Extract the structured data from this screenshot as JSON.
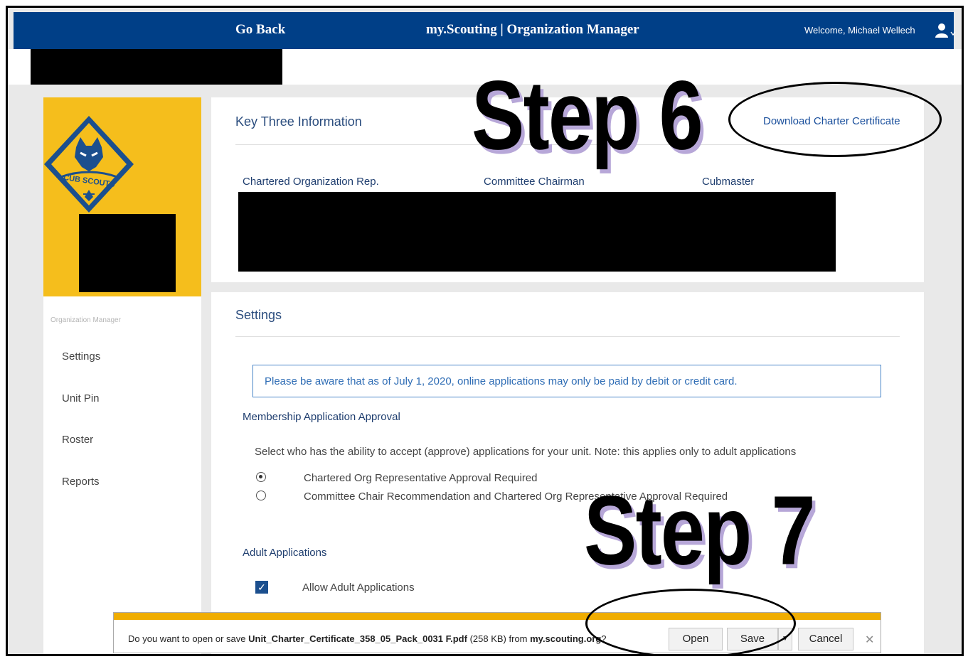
{
  "header": {
    "go_back": "Go Back",
    "brand": "my.Scouting |",
    "brand_section": "Organization Manager",
    "welcome": "Welcome, Michael Wellech",
    "user_icon": "user-icon"
  },
  "sidebar": {
    "logo_text": "CUB SCOUTS",
    "heading": "Organization Manager",
    "items": [
      {
        "label": "Settings"
      },
      {
        "label": "Unit Pin"
      },
      {
        "label": "Roster"
      },
      {
        "label": "Reports"
      }
    ]
  },
  "key_three": {
    "title": "Key Three Information",
    "download_link": "Download Charter Certificate",
    "columns": [
      "Chartered Organization Rep.",
      "Committee Chairman",
      "Cubmaster"
    ]
  },
  "settings": {
    "title": "Settings",
    "notice": "Please be aware that as of July 1, 2020, online applications may only be paid by debit or credit card.",
    "membership_label": "Membership Application Approval",
    "membership_desc": "Select who has the ability to accept (approve) applications for your unit. Note: this applies only to adult applications",
    "options": [
      {
        "label": "Chartered Org Representative Approval Required",
        "checked": true
      },
      {
        "label": "Committee Chair Recommendation and Chartered Org Representative Approval Required",
        "checked": false
      }
    ],
    "adult_label": "Adult Applications",
    "allow_adult": "Allow Adult Applications"
  },
  "annotations": {
    "step6": "Step 6",
    "step7": "Step 7"
  },
  "download_bar": {
    "prompt_prefix": "Do you want to open or save ",
    "filename": "Unit_Charter_Certificate_358_05_Pack_0031 F.pdf",
    "size": "(258 KB)",
    "from": " from ",
    "site": "my.scouting.org",
    "suffix": "?",
    "open": "Open",
    "save": "Save",
    "cancel": "Cancel",
    "close_icon": "close-icon"
  },
  "colors": {
    "header_blue": "#003f87",
    "cub_yellow": "#f5be1c",
    "download_stripe": "#f0ad00"
  }
}
